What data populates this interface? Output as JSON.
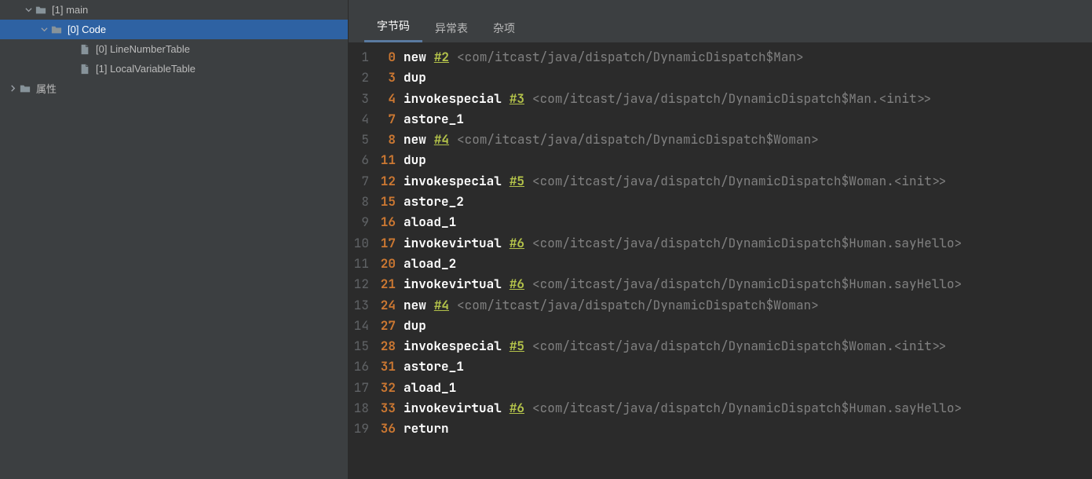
{
  "sidebar": {
    "tree": [
      {
        "indent": 28,
        "chevron": "down",
        "icon": "folder",
        "label": "[1] main",
        "selected": false
      },
      {
        "indent": 48,
        "chevron": "down",
        "icon": "folder",
        "label": "[0] Code",
        "selected": true
      },
      {
        "indent": 84,
        "chevron": "",
        "icon": "file",
        "label": "[0] LineNumberTable",
        "selected": false
      },
      {
        "indent": 84,
        "chevron": "",
        "icon": "file",
        "label": "[1] LocalVariableTable",
        "selected": false
      },
      {
        "indent": 8,
        "chevron": "right",
        "icon": "folder",
        "label": "属性",
        "selected": false
      }
    ]
  },
  "tabs": [
    {
      "label": "字节码",
      "active": true
    },
    {
      "label": "异常表",
      "active": false
    },
    {
      "label": "杂项",
      "active": false
    }
  ],
  "bytecode": [
    {
      "n": 1,
      "addr": "0",
      "op": "new",
      "ref": "#2",
      "comment": "<com/itcast/java/dispatch/DynamicDispatch$Man>"
    },
    {
      "n": 2,
      "addr": "3",
      "op": "dup",
      "ref": "",
      "comment": ""
    },
    {
      "n": 3,
      "addr": "4",
      "op": "invokespecial",
      "ref": "#3",
      "comment": "<com/itcast/java/dispatch/DynamicDispatch$Man.<init>>"
    },
    {
      "n": 4,
      "addr": "7",
      "op": "astore_1",
      "ref": "",
      "comment": ""
    },
    {
      "n": 5,
      "addr": "8",
      "op": "new",
      "ref": "#4",
      "comment": "<com/itcast/java/dispatch/DynamicDispatch$Woman>"
    },
    {
      "n": 6,
      "addr": "11",
      "op": "dup",
      "ref": "",
      "comment": ""
    },
    {
      "n": 7,
      "addr": "12",
      "op": "invokespecial",
      "ref": "#5",
      "comment": "<com/itcast/java/dispatch/DynamicDispatch$Woman.<init>>"
    },
    {
      "n": 8,
      "addr": "15",
      "op": "astore_2",
      "ref": "",
      "comment": ""
    },
    {
      "n": 9,
      "addr": "16",
      "op": "aload_1",
      "ref": "",
      "comment": ""
    },
    {
      "n": 10,
      "addr": "17",
      "op": "invokevirtual",
      "ref": "#6",
      "comment": "<com/itcast/java/dispatch/DynamicDispatch$Human.sayHello>"
    },
    {
      "n": 11,
      "addr": "20",
      "op": "aload_2",
      "ref": "",
      "comment": ""
    },
    {
      "n": 12,
      "addr": "21",
      "op": "invokevirtual",
      "ref": "#6",
      "comment": "<com/itcast/java/dispatch/DynamicDispatch$Human.sayHello>"
    },
    {
      "n": 13,
      "addr": "24",
      "op": "new",
      "ref": "#4",
      "comment": "<com/itcast/java/dispatch/DynamicDispatch$Woman>"
    },
    {
      "n": 14,
      "addr": "27",
      "op": "dup",
      "ref": "",
      "comment": ""
    },
    {
      "n": 15,
      "addr": "28",
      "op": "invokespecial",
      "ref": "#5",
      "comment": "<com/itcast/java/dispatch/DynamicDispatch$Woman.<init>>"
    },
    {
      "n": 16,
      "addr": "31",
      "op": "astore_1",
      "ref": "",
      "comment": ""
    },
    {
      "n": 17,
      "addr": "32",
      "op": "aload_1",
      "ref": "",
      "comment": ""
    },
    {
      "n": 18,
      "addr": "33",
      "op": "invokevirtual",
      "ref": "#6",
      "comment": "<com/itcast/java/dispatch/DynamicDispatch$Human.sayHello>"
    },
    {
      "n": 19,
      "addr": "36",
      "op": "return",
      "ref": "",
      "comment": ""
    }
  ]
}
